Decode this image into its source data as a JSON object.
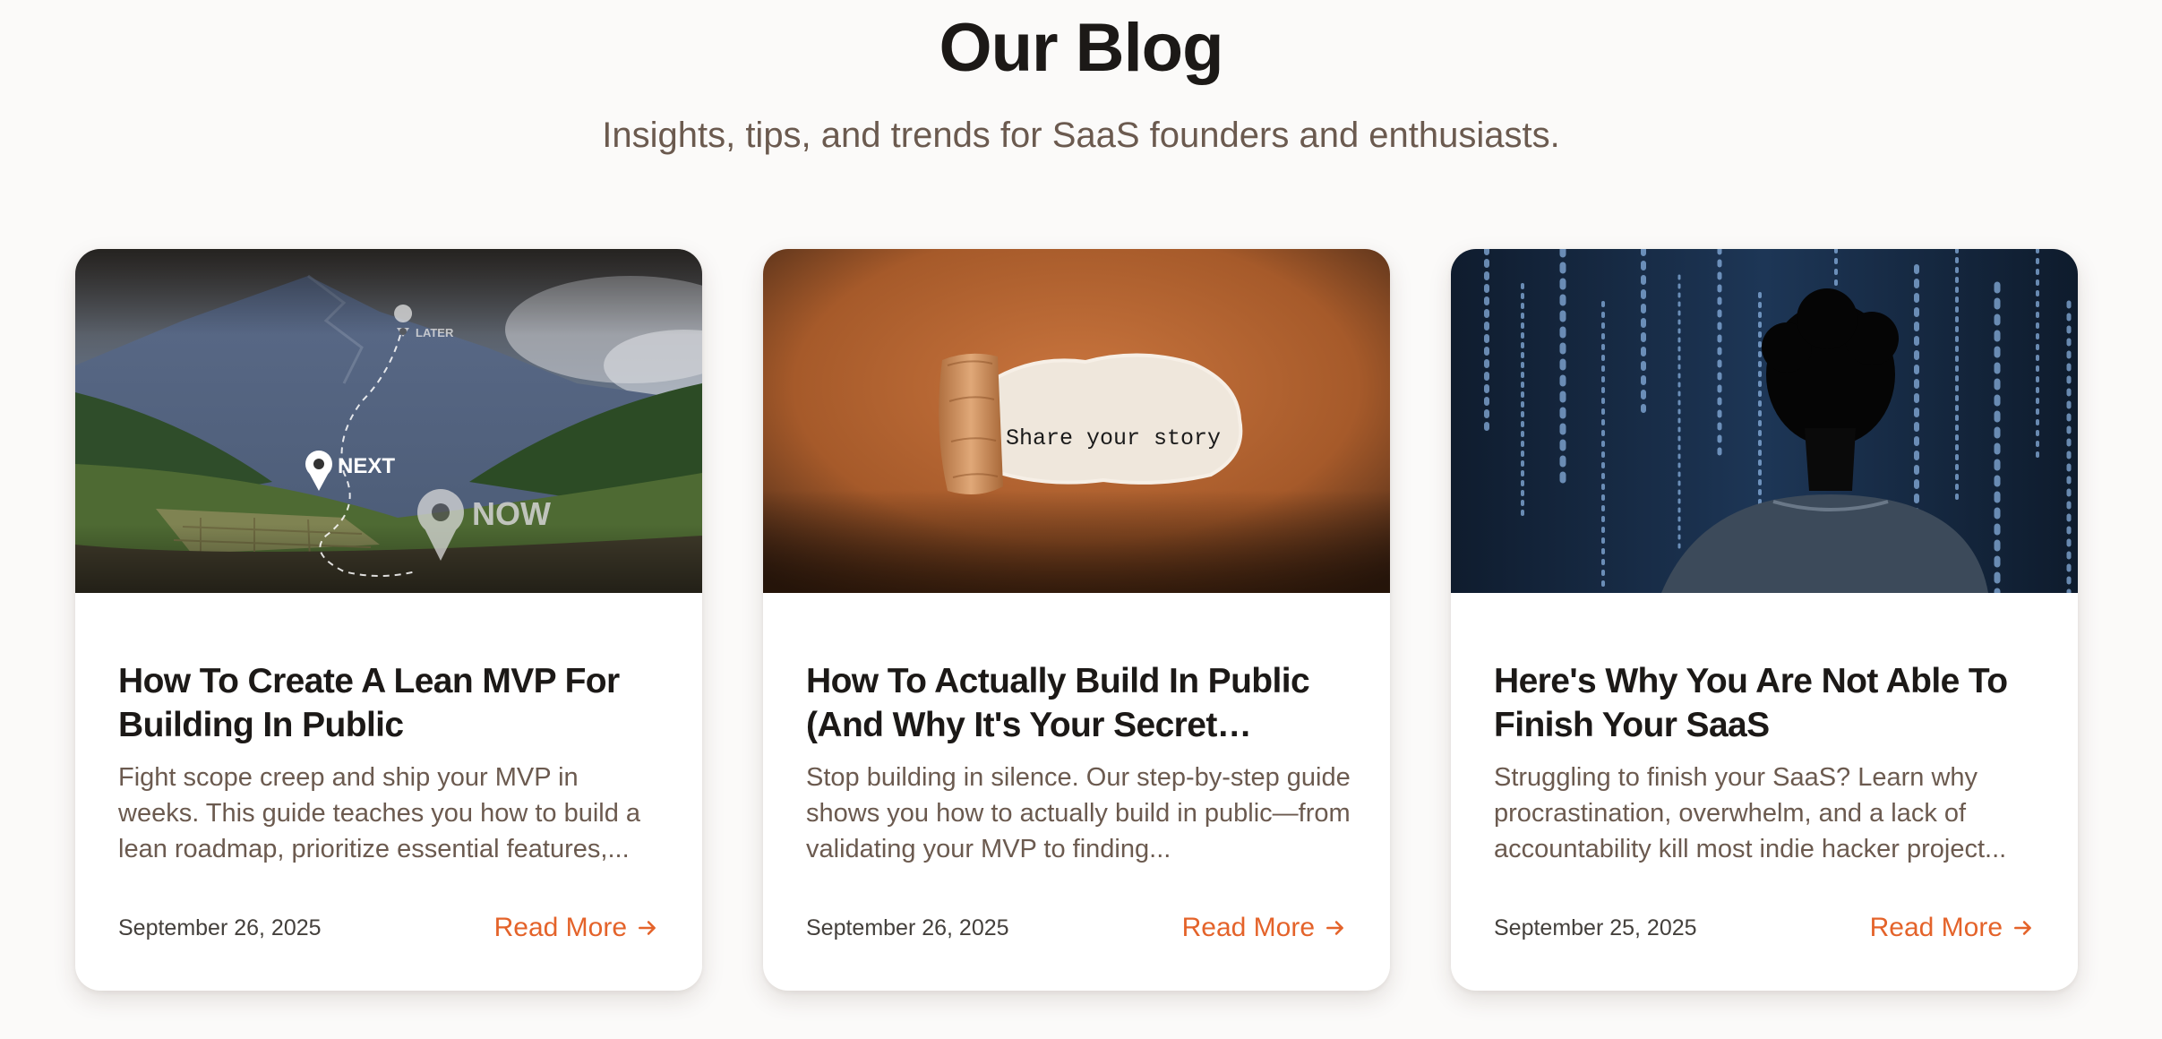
{
  "header": {
    "title": "Our Blog",
    "subtitle": "Insights, tips, and trends for SaaS founders and enthusiasts."
  },
  "posts": [
    {
      "title": "How To Create A Lean MVP For Building In Public",
      "excerpt": "Fight scope creep and ship your MVP in weeks. This guide teaches you how to build a lean roadmap, prioritize essential features,...",
      "date": "September 26, 2025",
      "read_more": "Read More",
      "image": {
        "labels": [
          "LATER",
          "NEXT",
          "NOW"
        ]
      }
    },
    {
      "title": "How To Actually Build In Public (And Why It's Your Secret…",
      "excerpt": "Stop building in silence. Our step-by-step guide shows you how to actually build in public—from validating your MVP to finding...",
      "date": "September 26, 2025",
      "read_more": "Read More",
      "image": {
        "text": "Share your story"
      }
    },
    {
      "title": "Here's Why You Are Not Able To Finish Your SaaS",
      "excerpt": "Struggling to finish your SaaS? Learn why procrastination, overwhelm, and a lack of accountability kill most indie hacker project...",
      "date": "September 25, 2025",
      "read_more": "Read More",
      "image": {}
    }
  ],
  "colors": {
    "accent": "#e4632a",
    "title": "#1c1917",
    "muted": "#6b5a4f",
    "background": "#fbfaf9"
  },
  "icons": {
    "read_more": "arrow-right-icon",
    "location": "map-pin-icon"
  }
}
